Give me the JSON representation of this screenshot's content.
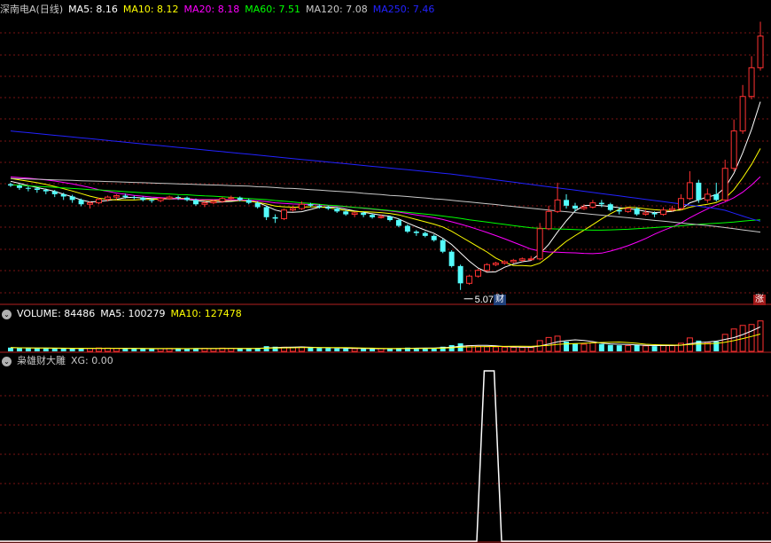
{
  "main_panel": {
    "title": "深南电A(日线)",
    "ma": [
      {
        "key": "ma5",
        "label": "MA5: 8.16",
        "color": "#ffffff"
      },
      {
        "key": "ma10",
        "label": "MA10: 8.12",
        "color": "#ffff00"
      },
      {
        "key": "ma20",
        "label": "MA20: 8.18",
        "color": "#ff00ff"
      },
      {
        "key": "ma60",
        "label": "MA60: 7.51",
        "color": "#00ff00"
      },
      {
        "key": "ma120",
        "label": "MA120: 7.08",
        "color": "#c8c8c8"
      },
      {
        "key": "ma250",
        "label": "MA250: 7.46",
        "color": "#2222ff"
      }
    ],
    "low_marker": "5.07",
    "cai_badge": "财",
    "zhang_badge": "涨"
  },
  "volume_panel": {
    "items": [
      {
        "label": "VOLUME: 84486",
        "color": "#ffffff"
      },
      {
        "label": "MA5: 100279",
        "color": "#ffffff"
      },
      {
        "label": "MA10: 127478",
        "color": "#ffff00"
      }
    ]
  },
  "indicator_panel": {
    "name": "枭雄财大雕",
    "value": "XG: 0.00",
    "signal": {
      "x_days": [
        0,
        0,
        0,
        0,
        0,
        0,
        0,
        1,
        1,
        0,
        0,
        0,
        0,
        0,
        0,
        0
      ]
    }
  },
  "colors": {
    "up": "#ff3232",
    "down": "#54fcfc",
    "grid": "#7a1414",
    "panel_border": "#b42020",
    "background": "#000000"
  },
  "chart_data": {
    "type": "candlestick",
    "price_series": {
      "open": [
        8.75,
        8.7,
        8.62,
        8.6,
        8.55,
        8.5,
        8.4,
        8.32,
        8.2,
        8.05,
        8.1,
        8.22,
        8.3,
        8.35,
        8.3,
        8.28,
        8.2,
        8.18,
        8.25,
        8.3,
        8.28,
        8.2,
        8.05,
        8.1,
        8.15,
        8.25,
        8.28,
        8.2,
        8.1,
        7.95,
        7.6,
        7.55,
        7.85,
        7.9,
        8.05,
        8.0,
        7.95,
        7.9,
        7.8,
        7.7,
        7.75,
        7.68,
        7.6,
        7.62,
        7.5,
        7.3,
        7.1,
        7.05,
        6.95,
        6.8,
        6.4,
        5.9,
        5.3,
        5.55,
        5.75,
        5.95,
        6.0,
        6.05,
        6.1,
        6.15,
        6.15,
        7.2,
        7.8,
        8.2,
        8.0,
        7.9,
        7.95,
        8.1,
        8.05,
        7.85,
        7.8,
        7.9,
        7.7,
        7.75,
        7.7,
        7.85,
        7.9,
        8.25,
        8.8,
        8.2,
        8.4,
        8.2,
        9.3,
        10.6,
        11.8,
        12.8
      ],
      "close": [
        8.7,
        8.62,
        8.6,
        8.55,
        8.5,
        8.4,
        8.32,
        8.2,
        8.05,
        8.1,
        8.22,
        8.3,
        8.35,
        8.3,
        8.28,
        8.2,
        8.18,
        8.25,
        8.3,
        8.28,
        8.2,
        8.05,
        8.1,
        8.15,
        8.25,
        8.28,
        8.2,
        8.1,
        7.95,
        7.6,
        7.55,
        7.85,
        7.9,
        8.05,
        8.0,
        7.95,
        7.9,
        7.8,
        7.7,
        7.75,
        7.68,
        7.6,
        7.62,
        7.5,
        7.3,
        7.1,
        7.05,
        6.95,
        6.8,
        6.4,
        5.9,
        5.3,
        5.55,
        5.75,
        5.95,
        6.0,
        6.05,
        6.1,
        6.15,
        6.15,
        7.2,
        7.8,
        8.2,
        8.0,
        7.9,
        7.95,
        8.1,
        8.05,
        7.85,
        7.8,
        7.9,
        7.7,
        7.75,
        7.7,
        7.85,
        7.9,
        8.25,
        8.8,
        8.2,
        8.4,
        8.2,
        9.3,
        10.6,
        11.8,
        12.8,
        13.9
      ],
      "high": [
        8.8,
        8.75,
        8.68,
        8.65,
        8.6,
        8.55,
        8.45,
        8.38,
        8.25,
        8.15,
        8.28,
        8.35,
        8.4,
        8.42,
        8.35,
        8.32,
        8.25,
        8.3,
        8.35,
        8.35,
        8.32,
        8.25,
        8.15,
        8.2,
        8.3,
        8.35,
        8.32,
        8.25,
        8.15,
        8.0,
        7.7,
        7.9,
        8.0,
        8.15,
        8.1,
        8.05,
        8.0,
        7.95,
        7.85,
        7.8,
        7.8,
        7.72,
        7.7,
        7.65,
        7.55,
        7.35,
        7.15,
        7.1,
        7.0,
        6.85,
        6.45,
        5.95,
        5.6,
        5.8,
        6.0,
        6.05,
        6.1,
        6.15,
        6.2,
        6.25,
        7.4,
        8.0,
        8.8,
        8.4,
        8.1,
        8.05,
        8.2,
        8.2,
        8.1,
        7.95,
        7.95,
        7.95,
        7.85,
        7.8,
        7.95,
        8.0,
        8.4,
        9.2,
        8.9,
        8.6,
        8.8,
        9.6,
        11.0,
        12.2,
        13.2,
        14.4
      ],
      "low": [
        8.65,
        8.55,
        8.5,
        8.45,
        8.4,
        8.3,
        8.2,
        8.1,
        7.98,
        7.9,
        8.05,
        8.15,
        8.2,
        8.25,
        8.22,
        8.15,
        8.1,
        8.12,
        8.2,
        8.2,
        8.15,
        8.0,
        7.95,
        8.05,
        8.1,
        8.2,
        8.15,
        8.05,
        7.9,
        7.5,
        7.4,
        7.5,
        7.8,
        7.85,
        7.95,
        7.9,
        7.85,
        7.75,
        7.65,
        7.6,
        7.6,
        7.55,
        7.55,
        7.45,
        7.25,
        7.05,
        6.95,
        6.9,
        6.75,
        6.35,
        5.85,
        5.07,
        5.25,
        5.5,
        5.7,
        5.9,
        5.95,
        6.0,
        6.05,
        6.1,
        6.1,
        7.15,
        7.75,
        7.9,
        7.8,
        7.85,
        7.9,
        7.95,
        7.8,
        7.7,
        7.75,
        7.65,
        7.65,
        7.6,
        7.65,
        7.8,
        7.85,
        8.2,
        8.1,
        8.1,
        8.15,
        8.15,
        9.2,
        10.5,
        11.7,
        12.7
      ]
    },
    "ma_lines": {
      "ma5": [
        8.85,
        8.78,
        8.7,
        8.63,
        8.57,
        8.5,
        8.4,
        8.31,
        8.2,
        8.13,
        8.15,
        8.18,
        8.22,
        8.28,
        8.29,
        8.27,
        8.25,
        8.24,
        8.24,
        8.24,
        8.22,
        8.18,
        8.14,
        8.12,
        8.13,
        8.15,
        8.18,
        8.18,
        8.12,
        7.99,
        7.85,
        7.78,
        7.77,
        7.79,
        7.87,
        7.95,
        7.96,
        7.94,
        7.88,
        7.82,
        7.77,
        7.72,
        7.67,
        7.63,
        7.54,
        7.4,
        7.27,
        7.15,
        7.04,
        6.87,
        6.65,
        6.36,
        6.07,
        5.83,
        5.69,
        5.7,
        5.86,
        5.97,
        6.05,
        6.09,
        6.33,
        6.65,
        7.08,
        7.47,
        7.82,
        8.0,
        8.02,
        8.0,
        7.97,
        7.93,
        7.9,
        7.86,
        7.8,
        7.76,
        7.78,
        7.8,
        7.88,
        8.1,
        8.2,
        8.31,
        8.37,
        8.63,
        9.13,
        9.84,
        10.66,
        11.62
      ],
      "ma10": [
        8.95,
        8.9,
        8.85,
        8.8,
        8.74,
        8.67,
        8.59,
        8.51,
        8.42,
        8.33,
        8.26,
        8.22,
        8.2,
        8.2,
        8.2,
        8.22,
        8.22,
        8.23,
        8.26,
        8.26,
        8.25,
        8.22,
        8.19,
        8.18,
        8.18,
        8.18,
        8.18,
        8.16,
        8.12,
        8.06,
        7.99,
        7.96,
        7.95,
        7.95,
        7.96,
        7.96,
        7.93,
        7.88,
        7.83,
        7.8,
        7.79,
        7.78,
        7.76,
        7.73,
        7.68,
        7.6,
        7.52,
        7.44,
        7.36,
        7.26,
        7.11,
        6.93,
        6.75,
        6.57,
        6.39,
        6.18,
        6.03,
        5.92,
        5.92,
        5.9,
        6.0,
        6.23,
        6.51,
        6.76,
        6.96,
        7.15,
        7.34,
        7.54,
        7.72,
        7.88,
        7.95,
        7.93,
        7.89,
        7.86,
        7.84,
        7.83,
        7.85,
        7.95,
        8.0,
        8.05,
        8.11,
        8.26,
        8.56,
        8.97,
        9.44,
        9.99
      ],
      "ma20": [
        9.0,
        8.98,
        8.96,
        8.93,
        8.9,
        8.86,
        8.81,
        8.76,
        8.7,
        8.63,
        8.56,
        8.5,
        8.44,
        8.4,
        8.36,
        8.33,
        8.3,
        8.28,
        8.26,
        8.24,
        8.23,
        8.22,
        8.21,
        8.21,
        8.21,
        8.2,
        8.2,
        8.19,
        8.17,
        8.14,
        8.1,
        8.08,
        8.06,
        8.05,
        8.04,
        8.03,
        8.01,
        7.99,
        7.96,
        7.94,
        7.91,
        7.88,
        7.85,
        7.82,
        7.78,
        7.73,
        7.68,
        7.63,
        7.58,
        7.52,
        7.44,
        7.36,
        7.27,
        7.17,
        7.07,
        6.96,
        6.85,
        6.73,
        6.61,
        6.49,
        6.42,
        6.39,
        6.38,
        6.37,
        6.36,
        6.34,
        6.33,
        6.35,
        6.42,
        6.51,
        6.61,
        6.73,
        6.86,
        7.01,
        7.14,
        7.26,
        7.4,
        7.58,
        7.74,
        7.89,
        8.02,
        8.13,
        8.28,
        8.47,
        8.72,
        9.01
      ],
      "ma60": [
        8.72,
        8.71,
        8.69,
        8.67,
        8.66,
        8.64,
        8.62,
        8.6,
        8.58,
        8.56,
        8.55,
        8.53,
        8.51,
        8.49,
        8.47,
        8.45,
        8.44,
        8.42,
        8.41,
        8.39,
        8.38,
        8.36,
        8.34,
        8.33,
        8.31,
        8.29,
        8.27,
        8.25,
        8.23,
        8.21,
        8.18,
        8.16,
        8.13,
        8.1,
        8.08,
        8.05,
        8.02,
        8.0,
        7.97,
        7.94,
        7.92,
        7.89,
        7.86,
        7.83,
        7.8,
        7.77,
        7.74,
        7.71,
        7.68,
        7.64,
        7.6,
        7.56,
        7.51,
        7.47,
        7.43,
        7.39,
        7.35,
        7.31,
        7.27,
        7.23,
        7.21,
        7.2,
        7.19,
        7.18,
        7.17,
        7.16,
        7.15,
        7.15,
        7.16,
        7.17,
        7.18,
        7.2,
        7.22,
        7.24,
        7.26,
        7.28,
        7.3,
        7.33,
        7.35,
        7.37,
        7.39,
        7.41,
        7.43,
        7.46,
        7.49,
        7.51
      ],
      "ma120": [
        8.95,
        8.94,
        8.93,
        8.92,
        8.91,
        8.9,
        8.89,
        8.88,
        8.87,
        8.86,
        8.85,
        8.84,
        8.83,
        8.82,
        8.81,
        8.8,
        8.79,
        8.78,
        8.77,
        8.76,
        8.75,
        8.74,
        8.73,
        8.72,
        8.71,
        8.7,
        8.69,
        8.68,
        8.66,
        8.65,
        8.63,
        8.61,
        8.6,
        8.58,
        8.56,
        8.54,
        8.52,
        8.5,
        8.48,
        8.46,
        8.43,
        8.41,
        8.39,
        8.36,
        8.34,
        8.32,
        8.29,
        8.27,
        8.24,
        8.22,
        8.19,
        8.16,
        8.13,
        8.1,
        8.07,
        8.04,
        8.0,
        7.97,
        7.94,
        7.91,
        7.88,
        7.85,
        7.82,
        7.79,
        7.76,
        7.73,
        7.7,
        7.67,
        7.64,
        7.61,
        7.58,
        7.55,
        7.52,
        7.49,
        7.46,
        7.43,
        7.4,
        7.37,
        7.34,
        7.31,
        7.28,
        7.24,
        7.2,
        7.16,
        7.12,
        7.08
      ],
      "ma250": [
        10.6,
        10.57,
        10.54,
        10.51,
        10.48,
        10.45,
        10.42,
        10.39,
        10.36,
        10.33,
        10.3,
        10.27,
        10.24,
        10.21,
        10.18,
        10.15,
        10.12,
        10.09,
        10.06,
        10.03,
        10.0,
        9.97,
        9.94,
        9.91,
        9.88,
        9.85,
        9.82,
        9.79,
        9.76,
        9.73,
        9.7,
        9.67,
        9.64,
        9.61,
        9.58,
        9.55,
        9.52,
        9.49,
        9.46,
        9.43,
        9.4,
        9.37,
        9.34,
        9.31,
        9.28,
        9.25,
        9.22,
        9.19,
        9.16,
        9.13,
        9.1,
        9.06,
        9.02,
        8.98,
        8.94,
        8.9,
        8.86,
        8.82,
        8.78,
        8.74,
        8.7,
        8.66,
        8.62,
        8.58,
        8.54,
        8.5,
        8.46,
        8.42,
        8.38,
        8.34,
        8.3,
        8.26,
        8.22,
        8.18,
        8.14,
        8.1,
        8.06,
        8.02,
        7.98,
        7.94,
        7.9,
        7.84,
        7.74,
        7.64,
        7.54,
        7.46
      ]
    },
    "volume": [
      42000,
      38000,
      36000,
      35000,
      34000,
      33000,
      32000,
      31000,
      30000,
      34000,
      38000,
      36000,
      33000,
      31000,
      30000,
      29000,
      28000,
      30000,
      32000,
      31000,
      29000,
      35000,
      33000,
      31000,
      36000,
      34000,
      30000,
      32000,
      38000,
      58000,
      52000,
      46000,
      42000,
      48000,
      40000,
      37000,
      35000,
      33000,
      32000,
      30000,
      29000,
      28000,
      30000,
      31000,
      36000,
      42000,
      38000,
      34000,
      40000,
      52000,
      70000,
      90000,
      64000,
      55000,
      52000,
      50000,
      47000,
      45000,
      44000,
      43000,
      120000,
      155000,
      170000,
      110000,
      88000,
      80000,
      96000,
      82000,
      72000,
      68000,
      64000,
      70000,
      62000,
      58000,
      66000,
      64000,
      90000,
      150000,
      120000,
      98000,
      110000,
      190000,
      250000,
      290000,
      300000,
      340000
    ]
  }
}
